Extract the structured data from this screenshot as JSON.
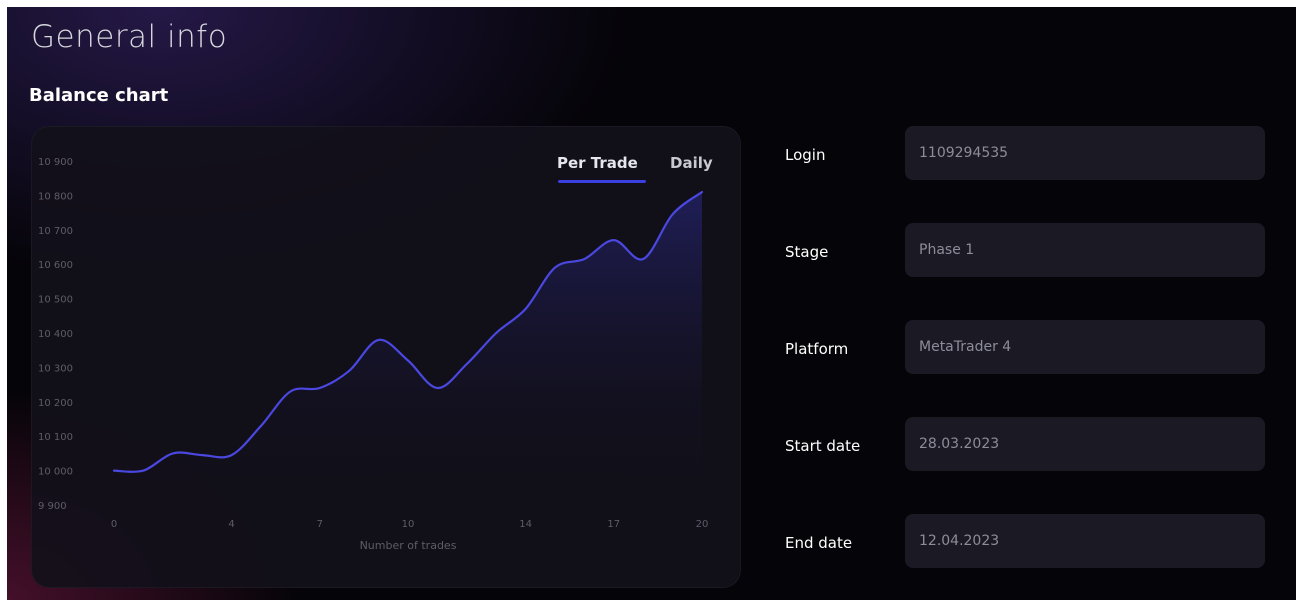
{
  "page": {
    "title": "General info",
    "chart_section_title": "Balance chart"
  },
  "tabs": [
    {
      "label": "Per Trade",
      "active": true
    },
    {
      "label": "Daily",
      "active": false
    }
  ],
  "fields": [
    {
      "label": "Login",
      "value": "1109294535"
    },
    {
      "label": "Stage",
      "value": "Phase 1"
    },
    {
      "label": "Platform",
      "value": "MetaTrader 4"
    },
    {
      "label": "Start date",
      "value": "28.03.2023"
    },
    {
      "label": "End date",
      "value": "12.04.2023"
    }
  ],
  "colors": {
    "accent": "#3b3fe0",
    "line": "#4a48e0",
    "background": "#050408",
    "card": "#12101a",
    "field": "#1b1a24"
  },
  "chart_data": {
    "type": "area",
    "xlabel": "Number of trades",
    "ylabel": "",
    "x_ticks": [
      0,
      4,
      7,
      10,
      14,
      17,
      20
    ],
    "y_ticks": [
      9900,
      10000,
      10100,
      10200,
      10300,
      10400,
      10500,
      10600,
      10700,
      10800,
      10900
    ],
    "y_tick_labels": [
      "9 900",
      "10 000",
      "10 100",
      "10 200",
      "10 300",
      "10 400",
      "10 500",
      "10 600",
      "10 700",
      "10 800",
      "10 900"
    ],
    "xlim": [
      0,
      20
    ],
    "ylim": [
      9900,
      10900
    ],
    "grid": false,
    "series": [
      {
        "x": [
          0,
          1,
          2,
          3,
          4,
          5,
          6,
          7,
          8,
          9,
          10,
          11,
          12,
          13,
          14,
          15,
          16,
          17,
          18,
          19,
          20
        ],
        "values": [
          10000,
          10000,
          10050,
          10045,
          10045,
          10130,
          10230,
          10240,
          10290,
          10380,
          10320,
          10240,
          10310,
          10400,
          10470,
          10590,
          10615,
          10670,
          10615,
          10745,
          10810
        ]
      }
    ]
  }
}
